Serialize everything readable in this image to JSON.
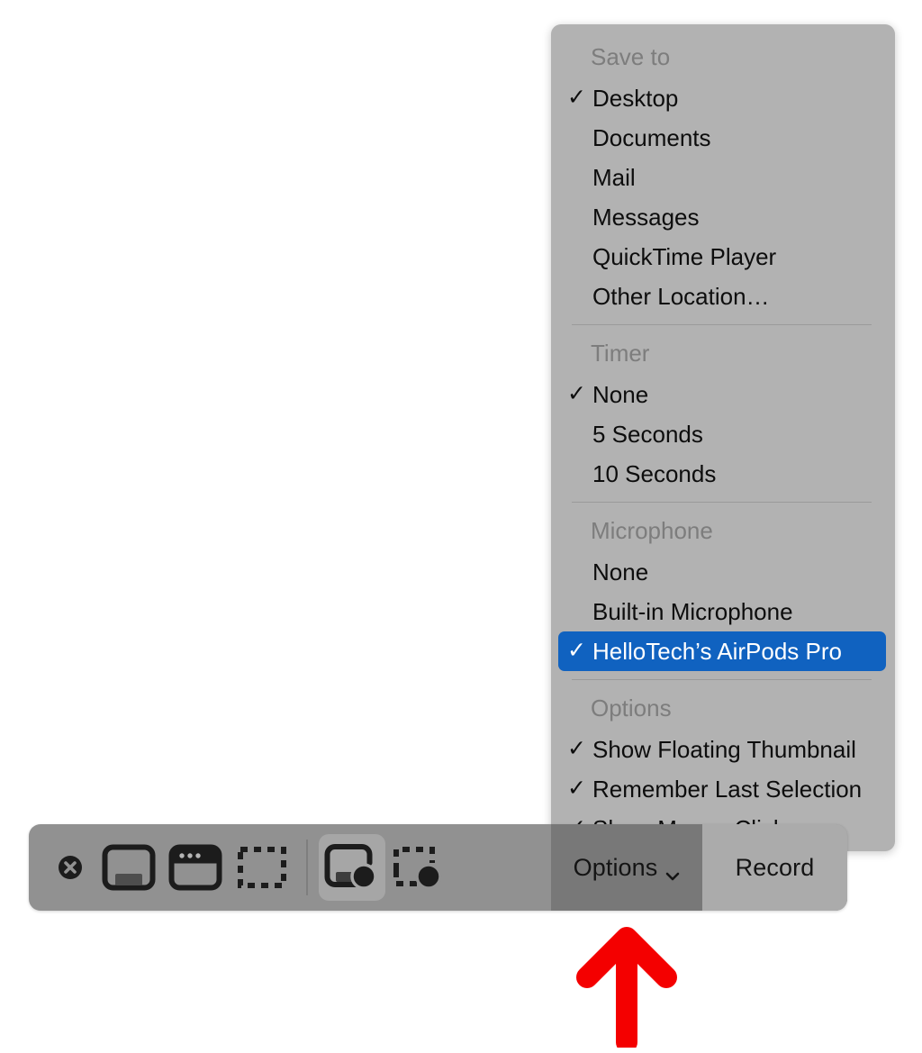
{
  "colors": {
    "menu_background": "#b2b2b2",
    "toolbar_background": "#919191",
    "highlight_blue": "#1062c0",
    "arrow_red": "#f40000",
    "options_button_active": "#787878",
    "record_button": "#ababab"
  },
  "toolbar": {
    "name": "screenshot-toolbar",
    "close_label": "✕",
    "icons": [
      {
        "name": "capture-entire-screen",
        "label": "Capture Entire Screen",
        "selected": false
      },
      {
        "name": "capture-selected-window",
        "label": "Capture Selected Window",
        "selected": false
      },
      {
        "name": "capture-selected-portion",
        "label": "Capture Selected Portion",
        "selected": false
      },
      {
        "name": "record-entire-screen",
        "label": "Record Entire Screen",
        "selected": true
      },
      {
        "name": "record-selected-portion",
        "label": "Record Selected Portion",
        "selected": false
      }
    ],
    "options_label": "Options",
    "options_chevron": "chevron-down-icon",
    "record_label": "Record"
  },
  "options_menu": {
    "sections": [
      {
        "header": "Save to",
        "items": [
          {
            "label": "Desktop",
            "checked": true
          },
          {
            "label": "Documents",
            "checked": false
          },
          {
            "label": "Mail",
            "checked": false
          },
          {
            "label": "Messages",
            "checked": false
          },
          {
            "label": "QuickTime Player",
            "checked": false
          },
          {
            "label": "Other Location…",
            "checked": false
          }
        ]
      },
      {
        "header": "Timer",
        "items": [
          {
            "label": "None",
            "checked": true
          },
          {
            "label": "5 Seconds",
            "checked": false
          },
          {
            "label": "10 Seconds",
            "checked": false
          }
        ]
      },
      {
        "header": "Microphone",
        "items": [
          {
            "label": "None",
            "checked": false
          },
          {
            "label": "Built-in Microphone",
            "checked": false
          },
          {
            "label": "HelloTech’s AirPods Pro",
            "checked": true,
            "highlighted": true
          }
        ]
      },
      {
        "header": "Options",
        "items": [
          {
            "label": "Show Floating Thumbnail",
            "checked": true
          },
          {
            "label": "Remember Last Selection",
            "checked": true
          },
          {
            "label": "Show Mouse Clicks",
            "checked": true
          }
        ]
      }
    ],
    "checkmark": "✓"
  },
  "annotation": {
    "arrow": "up-arrow-annotation",
    "points_to": "Options"
  }
}
